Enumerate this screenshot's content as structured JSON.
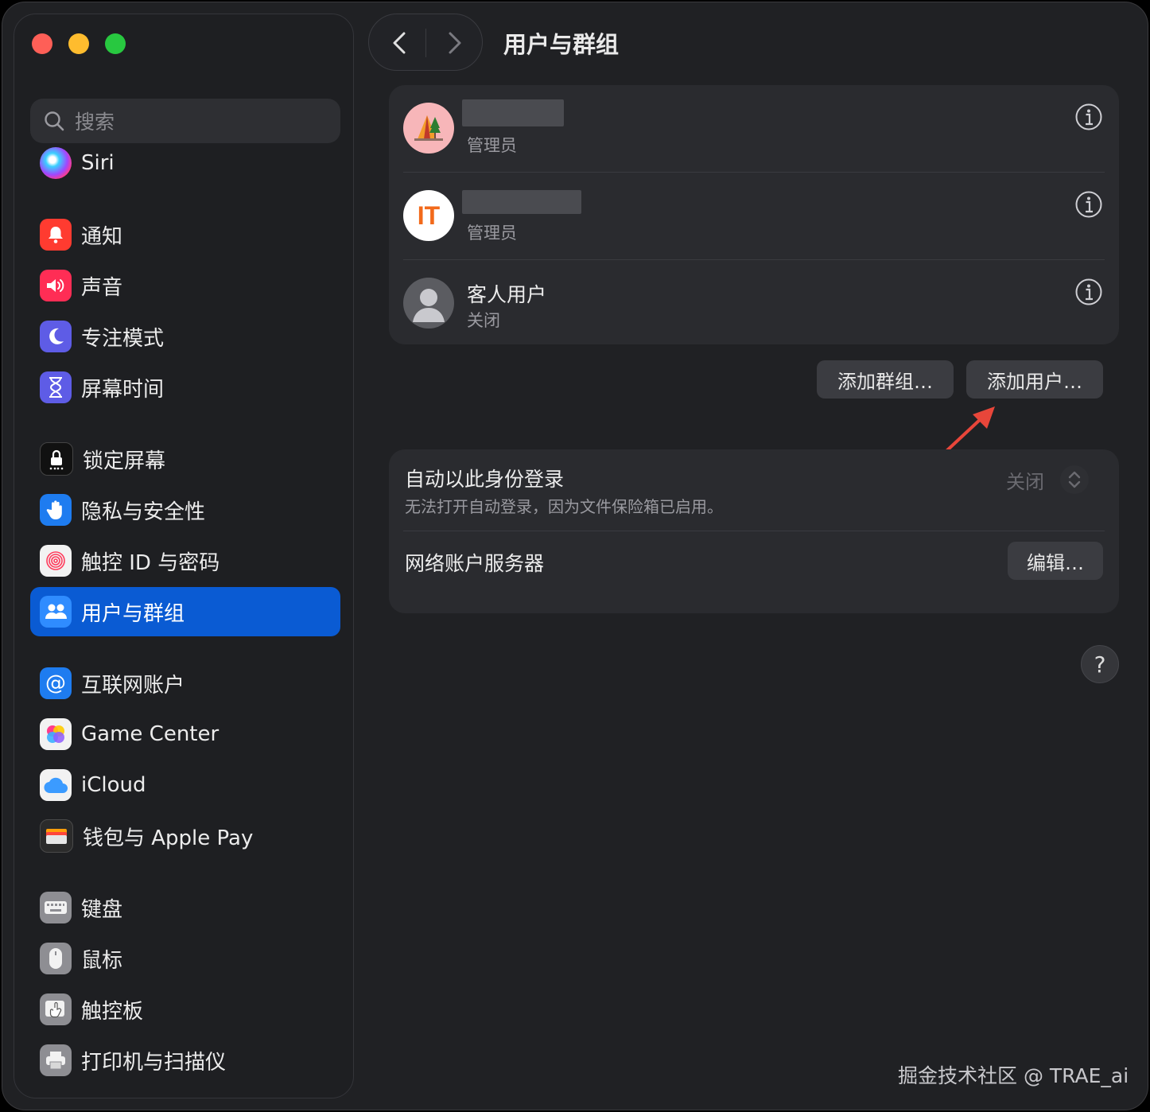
{
  "window": {
    "title": "用户与群组"
  },
  "sidebar": {
    "search_placeholder": "搜索",
    "items": [
      {
        "label": "Siri",
        "icon": "siri-icon"
      },
      {
        "label": "通知",
        "icon": "notifications-icon",
        "color": "#ff3b30"
      },
      {
        "label": "声音",
        "icon": "sound-icon",
        "color": "#ff2d55"
      },
      {
        "label": "专注模式",
        "icon": "moon-icon",
        "color": "#5e5ce6"
      },
      {
        "label": "屏幕时间",
        "icon": "hourglass-icon",
        "color": "#5e5ce6"
      },
      {
        "label": "锁定屏幕",
        "icon": "lock-screen-icon",
        "color": "#111111"
      },
      {
        "label": "隐私与安全性",
        "icon": "hand-icon",
        "color": "#1e7cf0"
      },
      {
        "label": "触控 ID 与密码",
        "icon": "fingerprint-icon",
        "color": "#f2f2f2"
      },
      {
        "label": "用户与群组",
        "icon": "users-icon",
        "color": "#1e7cf0",
        "active": true
      },
      {
        "label": "互联网账户",
        "icon": "at-icon",
        "color": "#1e7cf0"
      },
      {
        "label": "Game Center",
        "icon": "game-center-icon",
        "color": "#f2f2f2"
      },
      {
        "label": "iCloud",
        "icon": "cloud-icon",
        "color": "#f2f2f2"
      },
      {
        "label": "钱包与 Apple Pay",
        "icon": "wallet-icon",
        "color": "#2b2b2b"
      },
      {
        "label": "键盘",
        "icon": "keyboard-icon",
        "color": "#8e8e93"
      },
      {
        "label": "鼠标",
        "icon": "mouse-icon",
        "color": "#8e8e93"
      },
      {
        "label": "触控板",
        "icon": "trackpad-icon",
        "color": "#8e8e93"
      },
      {
        "label": "打印机与扫描仪",
        "icon": "printer-icon",
        "color": "#8e8e93"
      }
    ]
  },
  "users": [
    {
      "role": "管理员",
      "avatar": "camping-tent-avatar"
    },
    {
      "role": "管理员",
      "avatar": "it-logo-avatar",
      "avatar_text": "IT"
    },
    {
      "name": "客人用户",
      "role": "关闭",
      "avatar": "guest-avatar"
    }
  ],
  "buttons": {
    "add_group": "添加群组…",
    "add_user": "添加用户…",
    "edit": "编辑…"
  },
  "auto_login": {
    "title": "自动以此身份登录",
    "subtitle": "无法打开自动登录，因为文件保险箱已启用。",
    "value": "关闭"
  },
  "network_server": {
    "title": "网络账户服务器"
  },
  "help_label": "?",
  "watermark": "掘金技术社区 @ TRAE_ai",
  "colors": {
    "accent": "#0a5bd3",
    "annotation_arrow": "#e8463a"
  }
}
